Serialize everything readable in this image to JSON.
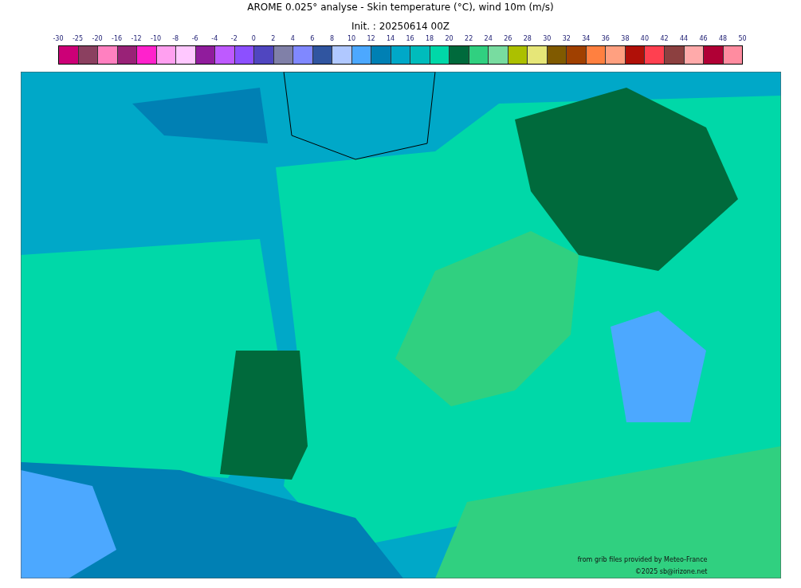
{
  "title": "AROME 0.025° analyse - Skin temperature (°C), wind 10m (m/s)",
  "subtitle": "Init. : 20250614 00Z",
  "colorbar": {
    "ticks": [
      "-30",
      "-25",
      "-20",
      "-16",
      "-12",
      "-10",
      "-8",
      "-6",
      "-4",
      "-2",
      "0",
      "2",
      "4",
      "6",
      "8",
      "10",
      "12",
      "14",
      "16",
      "18",
      "20",
      "22",
      "24",
      "26",
      "28",
      "30",
      "32",
      "34",
      "36",
      "38",
      "40",
      "42",
      "44",
      "46",
      "48",
      "50"
    ],
    "swatches": [
      {
        "color": "#cc0077"
      },
      {
        "color": "#8b4060"
      },
      {
        "color": "#ff80c0"
      },
      {
        "color": "#992277"
      },
      {
        "color": "#ff22cc"
      },
      {
        "color": "#ffa0f0"
      },
      {
        "color": "#ffc8ff"
      },
      {
        "color": "#901c9c"
      },
      {
        "color": "#be5aff"
      },
      {
        "color": "#8c50ff"
      },
      {
        "color": "#5046c0"
      },
      {
        "color": "#8080a8"
      },
      {
        "color": "#8088ff"
      },
      {
        "color": "#3055a0"
      },
      {
        "color": "#b0c8ff"
      },
      {
        "color": "#4ca8ff"
      },
      {
        "color": "#0080b4"
      },
      {
        "color": "#00a8c8"
      },
      {
        "color": "#00bcbc"
      },
      {
        "color": "#00d8a8"
      },
      {
        "color": "#006a3c"
      },
      {
        "color": "#30d080"
      },
      {
        "color": "#78dca0"
      },
      {
        "color": "#acc000"
      },
      {
        "color": "#e6e678"
      },
      {
        "color": "#805a00"
      },
      {
        "color": "#a04000"
      },
      {
        "color": "#ff8040"
      },
      {
        "color": "#ffa080"
      },
      {
        "color": "#b01008"
      },
      {
        "color": "#ff4050"
      },
      {
        "color": "#8c4040"
      },
      {
        "color": "#ffaaaa"
      },
      {
        "color": "#b00035"
      },
      {
        "color": "#ff8ca0"
      }
    ]
  },
  "credits": [
    "from grib files provided by Meteo-France",
    "©2025 sb@irizone.net"
  ]
}
